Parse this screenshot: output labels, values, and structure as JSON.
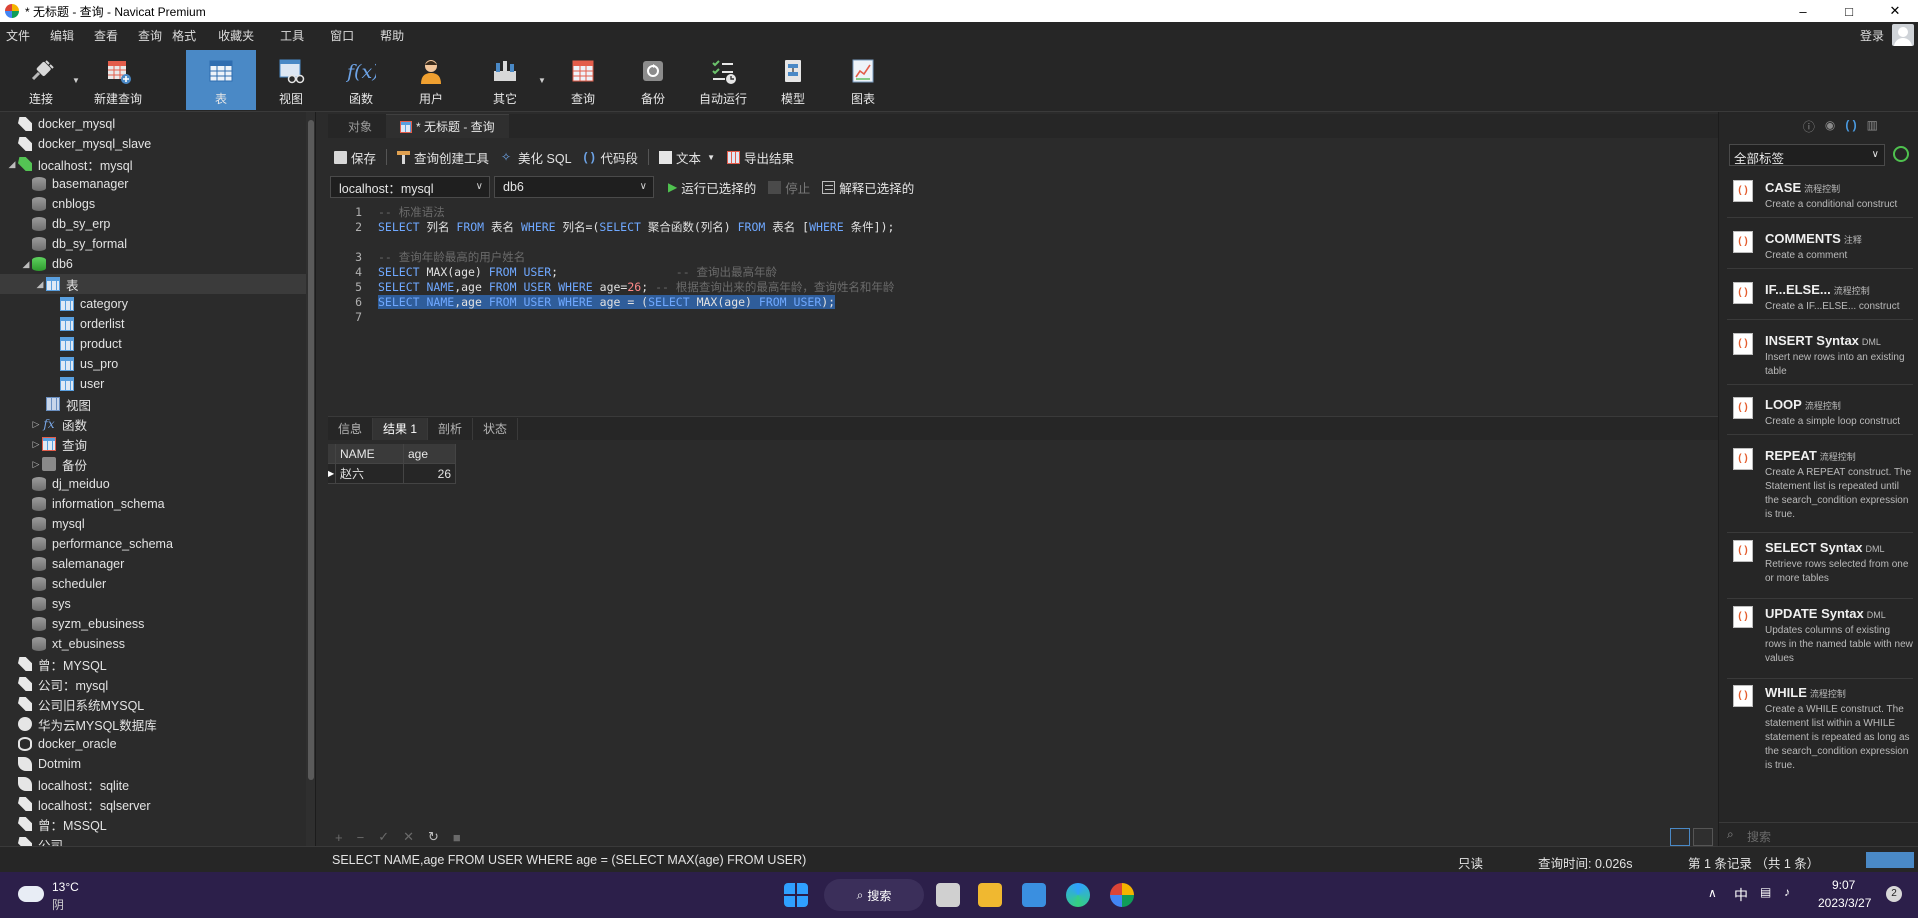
{
  "window": {
    "title": "* 无标题 - 查询 - Navicat Premium",
    "controls": [
      "minimize-icon",
      "maximize-icon",
      "close-icon"
    ]
  },
  "menu": {
    "items": [
      "文件",
      "编辑",
      "查看",
      "查询",
      "格式",
      "收藏夹",
      "工具",
      "窗口",
      "帮助"
    ],
    "login": "登录"
  },
  "toolbar": {
    "buttons": [
      {
        "label": "连接",
        "icon": "plug-icon"
      },
      {
        "label": "新建查询",
        "icon": "new-query-icon"
      },
      {
        "label": "表",
        "icon": "table-icon",
        "active": true
      },
      {
        "label": "视图",
        "icon": "view-icon"
      },
      {
        "label": "函数",
        "icon": "function-icon"
      },
      {
        "label": "用户",
        "icon": "user-icon"
      },
      {
        "label": "其它",
        "icon": "tools-icon"
      },
      {
        "label": "查询",
        "icon": "query-icon"
      },
      {
        "label": "备份",
        "icon": "backup-icon"
      },
      {
        "label": "自动运行",
        "icon": "automation-icon"
      },
      {
        "label": "模型",
        "icon": "model-icon"
      },
      {
        "label": "图表",
        "icon": "chart-icon"
      }
    ]
  },
  "tree": {
    "items": [
      {
        "label": "docker_mysql",
        "icon": "connection-icon"
      },
      {
        "label": "docker_mysql_slave",
        "icon": "connection-icon"
      },
      {
        "label": "localhost：mysql",
        "icon": "connection-icon",
        "expanded": true
      },
      {
        "label": "basemanager",
        "icon": "database-icon"
      },
      {
        "label": "cnblogs",
        "icon": "database-icon"
      },
      {
        "label": "db_sy_erp",
        "icon": "database-icon"
      },
      {
        "label": "db_sy_formal",
        "icon": "database-icon"
      },
      {
        "label": "db6",
        "icon": "database-icon",
        "expanded": true
      },
      {
        "label": "表",
        "icon": "table-icon",
        "expanded": true,
        "selected": true
      },
      {
        "label": "category",
        "icon": "table-icon"
      },
      {
        "label": "orderlist",
        "icon": "table-icon"
      },
      {
        "label": "product",
        "icon": "table-icon"
      },
      {
        "label": "us_pro",
        "icon": "table-icon"
      },
      {
        "label": "user",
        "icon": "table-icon"
      },
      {
        "label": "视图",
        "icon": "view-icon"
      },
      {
        "label": "函数",
        "icon": "function-icon"
      },
      {
        "label": "查询",
        "icon": "query-icon"
      },
      {
        "label": "备份",
        "icon": "backup-icon"
      },
      {
        "label": "dj_meiduo",
        "icon": "database-icon"
      },
      {
        "label": "information_schema",
        "icon": "database-icon"
      },
      {
        "label": "mysql",
        "icon": "database-icon"
      },
      {
        "label": "performance_schema",
        "icon": "database-icon"
      },
      {
        "label": "salemanager",
        "icon": "database-icon"
      },
      {
        "label": "scheduler",
        "icon": "database-icon"
      },
      {
        "label": "sys",
        "icon": "database-icon"
      },
      {
        "label": "syzm_ebusiness",
        "icon": "database-icon"
      },
      {
        "label": "xt_ebusiness",
        "icon": "database-icon"
      },
      {
        "label": "曾：MYSQL",
        "icon": "connection-icon"
      },
      {
        "label": "公司：mysql",
        "icon": "connection-icon"
      },
      {
        "label": "公司旧系统MYSQL",
        "icon": "connection-icon"
      },
      {
        "label": "华为云MYSQL数据库",
        "icon": "cloud-connection-icon"
      },
      {
        "label": "docker_oracle",
        "icon": "oracle-connection-icon"
      },
      {
        "label": "Dotmim",
        "icon": "sqlite-connection-icon"
      },
      {
        "label": "localhost：sqlite",
        "icon": "sqlite-connection-icon"
      },
      {
        "label": "localhost：sqlserver",
        "icon": "sqlserver-connection-icon"
      },
      {
        "label": "曾：MSSQL",
        "icon": "sqlserver-connection-icon"
      },
      {
        "label": "公司",
        "icon": "connection-icon"
      }
    ]
  },
  "tabs": [
    {
      "label": "对象",
      "active": false
    },
    {
      "label": "* 无标题 - 查询",
      "active": true
    }
  ],
  "editor_toolbar": {
    "save": "保存",
    "query_builder": "查询创建工具",
    "beautify": "美化 SQL",
    "snippet": "代码段",
    "text": "文本",
    "export": "导出结果"
  },
  "connection_bar": {
    "connection": "localhost：mysql",
    "database": "db6",
    "run_selected": "运行已选择的",
    "stop": "停止",
    "explain_selected": "解释已选择的"
  },
  "code": {
    "line_numbers": [
      "1",
      "2",
      "3",
      "4",
      "5",
      "6",
      "7"
    ]
  },
  "result_tabs": [
    "信息",
    "结果 1",
    "剖析",
    "状态"
  ],
  "result": {
    "columns": [
      "NAME",
      "age"
    ],
    "rows": [
      [
        "赵六",
        "26"
      ]
    ]
  },
  "snippets": {
    "filter": "全部标签",
    "items": [
      {
        "title": "CASE",
        "tag": "流程控制",
        "desc": "Create a conditional construct"
      },
      {
        "title": "COMMENTS",
        "tag": "注释",
        "desc": "Create a comment"
      },
      {
        "title": "IF...ELSE...",
        "tag": "流程控制",
        "desc": "Create a IF...ELSE... construct"
      },
      {
        "title": "INSERT Syntax",
        "tag": "DML",
        "desc": "Insert new rows into an existing table"
      },
      {
        "title": "LOOP",
        "tag": "流程控制",
        "desc": "Create a simple loop construct"
      },
      {
        "title": "REPEAT",
        "tag": "流程控制",
        "desc": "Create A REPEAT construct. The Statement list is repeated until the search_condition expression is true."
      },
      {
        "title": "SELECT Syntax",
        "tag": "DML",
        "desc": "Retrieve rows selected from one or more tables"
      },
      {
        "title": "UPDATE Syntax",
        "tag": "DML",
        "desc": "Updates columns of existing rows in the named table with new values"
      },
      {
        "title": "WHILE",
        "tag": "流程控制",
        "desc": "Create a WHILE construct. The statement list within a WHILE statement is repeated as long as the search_condition expression is true."
      }
    ],
    "search_placeholder": "搜索"
  },
  "status": {
    "sql": "SELECT NAME,age FROM USER WHERE age = (SELECT MAX(age) FROM USER)",
    "readonly": "只读",
    "query_time": "查询时间: 0.026s",
    "records": "第 1 条记录 （共 1 条）"
  },
  "taskbar": {
    "weather_temp": "13°C",
    "weather_desc": "阴",
    "search": "搜索",
    "ime": "中",
    "time": "9:07",
    "date": "2023/3/27",
    "notifications": "2"
  }
}
